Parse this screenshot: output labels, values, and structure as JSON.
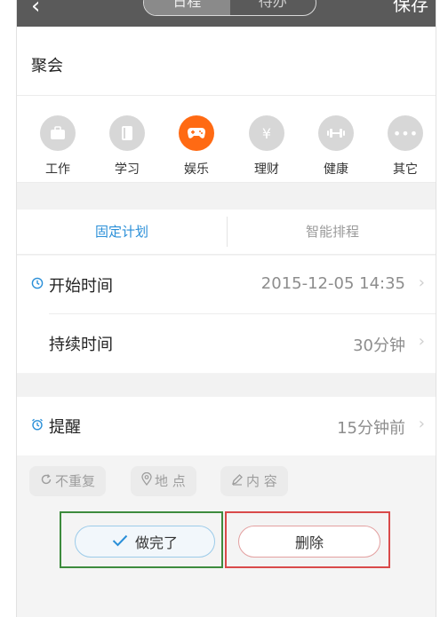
{
  "header": {
    "back_icon": "‹",
    "tabs": [
      {
        "label": "日程",
        "active": true
      },
      {
        "label": "待办",
        "active": false
      }
    ],
    "save_label": "保存"
  },
  "title": "聚会",
  "categories": [
    {
      "label": "工作",
      "icon": "briefcase-icon",
      "glyph": "▭"
    },
    {
      "label": "学习",
      "icon": "book-icon",
      "glyph": "▯"
    },
    {
      "label": "娱乐",
      "icon": "gamepad-icon",
      "glyph": "🎮",
      "active": true
    },
    {
      "label": "理财",
      "icon": "yen-icon",
      "glyph": "¥"
    },
    {
      "label": "健康",
      "icon": "dumbbell-icon",
      "glyph": "⫼"
    },
    {
      "label": "其它",
      "icon": "more-icon",
      "glyph": "•••"
    }
  ],
  "plan_tabs": [
    {
      "label": "固定计划",
      "active": true
    },
    {
      "label": "智能排程",
      "active": false
    }
  ],
  "start_time": {
    "label": "开始时间",
    "value": "2015-12-05 14:35"
  },
  "duration": {
    "label": "持续时间",
    "value": "30分钟"
  },
  "reminder": {
    "label": "提醒",
    "value": "15分钟前"
  },
  "chips": {
    "repeat": "不重复",
    "location": "地 点",
    "content": "内 容"
  },
  "actions": {
    "done_label": "做完了",
    "delete_label": "删除"
  },
  "colors": {
    "accent": "#2a8fd8",
    "active_category": "#ff6a13",
    "frame_green": "#3d8b3d",
    "frame_red": "#d94a4a"
  }
}
